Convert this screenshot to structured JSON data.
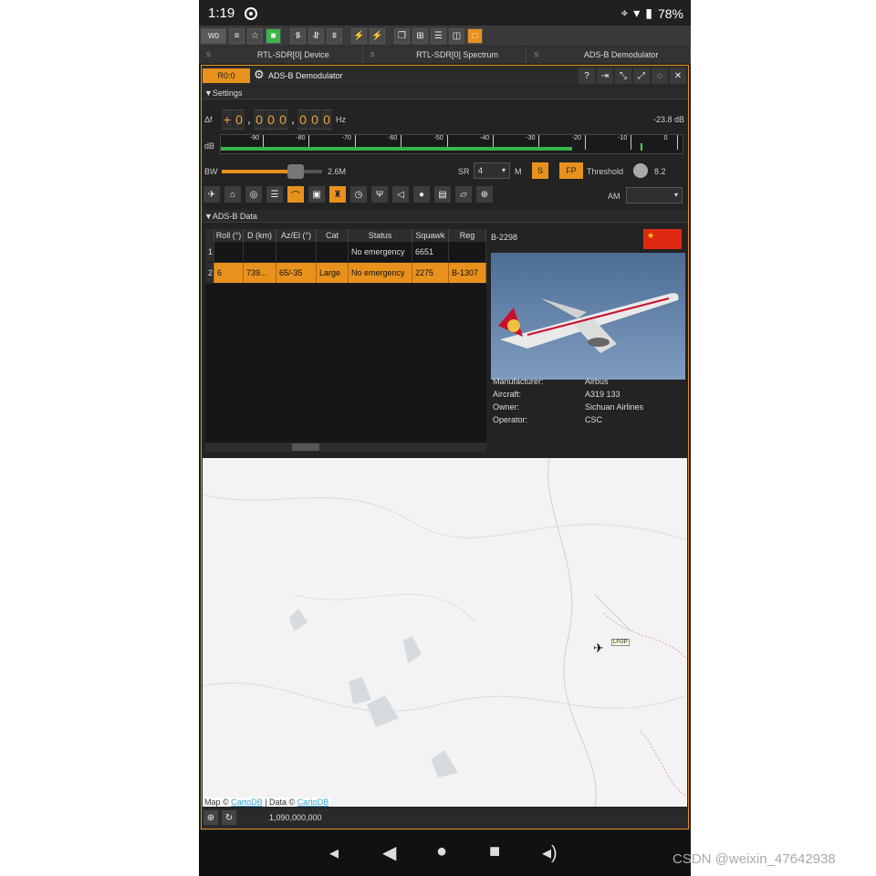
{
  "status_bar": {
    "time": "1:19",
    "battery": "78%"
  },
  "toolbar": {
    "workspace": "W0"
  },
  "tabs": [
    {
      "label": "RTL-SDR[0] Device",
      "icon_text": "S"
    },
    {
      "label": "RTL-SDR[0] Spectrum",
      "icon_text": "S"
    },
    {
      "label": "ADS-B Demodulator",
      "icon_text": "S"
    }
  ],
  "panel": {
    "index": "R0:0",
    "title": "ADS-B Demodulator",
    "settings_label": "Settings",
    "data_label": "ADS-B Data"
  },
  "settings": {
    "delta_label": "Δf",
    "freq_digits": [
      "+",
      "0",
      ",",
      "0",
      "0",
      "0",
      ",",
      "0",
      "0",
      "0"
    ],
    "freq_unit": "Hz",
    "level": "-23.8 dB",
    "db_label": "dB",
    "db_ticks": [
      "-90",
      "-80",
      "-70",
      "-60",
      "-50",
      "-40",
      "-30",
      "-20",
      "-10",
      "0"
    ],
    "meter_level": 0.76,
    "bw_label": "BW",
    "bw_value": "2.6M",
    "bw_slider": 0.75,
    "sr_label": "SR",
    "sr_value": "4",
    "sr_unit": "M",
    "s_button": "S",
    "fp_button": "FP",
    "threshold_label": "Threshold",
    "threshold_value": "8.2",
    "am_label": "AM",
    "am_value": ""
  },
  "table": {
    "headers": [
      "Roll (°)",
      "D (km)",
      "Az/El (°)",
      "Cat",
      "Status",
      "Squawk",
      "Reg"
    ],
    "rows": [
      {
        "idx": "1",
        "cells": [
          "",
          "",
          "",
          "",
          "No emergency",
          "6651",
          ""
        ]
      },
      {
        "idx": "2",
        "cells": [
          "6",
          "739...",
          "65/-35",
          "Large",
          "No emergency",
          "2275",
          "B-1307"
        ]
      }
    ]
  },
  "aircraft": {
    "registration": "B-2298",
    "manufacturer_label": "Manufacturer:",
    "manufacturer": "Airbus",
    "aircraft_label": "Aircraft:",
    "aircraft": "A319 133",
    "owner_label": "Owner:",
    "owner": "Sichuan Airlines",
    "operator_label": "Operator:",
    "operator": "CSC"
  },
  "map": {
    "attr_prefix": "Map ©",
    "attr_link1": "CartoDB",
    "attr_mid": "| Data ©",
    "attr_link2": "CartoDB",
    "marker_label": "LFGP"
  },
  "bottom": {
    "frequency": "1,090,000,000"
  },
  "watermark": "CSDN @weixin_47642938",
  "colors": {
    "accent": "#e8921d",
    "green": "#39b54a"
  }
}
